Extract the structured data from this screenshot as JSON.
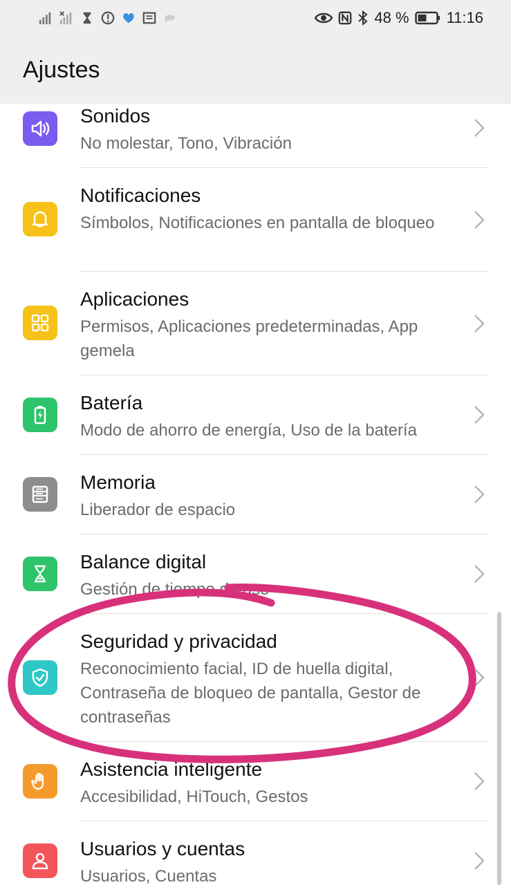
{
  "status_bar": {
    "left_icons": [
      "signal-icon",
      "signal-no-service-icon",
      "hourglass-icon",
      "alert-icon",
      "heart-chat-icon",
      "news-icon",
      "message-icon"
    ],
    "right_icons": [
      "eye-comfort-icon",
      "nfc-icon",
      "bluetooth-icon"
    ],
    "battery_percent": "48 %",
    "battery_level": 0.48,
    "time": "11:16"
  },
  "header": {
    "title": "Ajustes"
  },
  "colors": {
    "sound": "#7a5cf0",
    "notifications": "#f6c21a",
    "apps": "#f6c21a",
    "battery": "#2ec46b",
    "memory": "#8d8d8d",
    "digital_balance": "#2ec46b",
    "security": "#2fc6c6",
    "assistance": "#f59a2c",
    "users": "#f2555a",
    "annotation": "#d8317b"
  },
  "items": [
    {
      "icon": "speaker-icon",
      "title": "Sonidos",
      "subtitle": "No molestar, Tono, Vibración"
    },
    {
      "icon": "bell-icon",
      "title": "Notificaciones",
      "subtitle": "Símbolos, Notificaciones en pantalla de bloqueo"
    },
    {
      "icon": "apps-grid-icon",
      "title": "Aplicaciones",
      "subtitle": "Permisos, Aplicaciones predeterminadas, App gemela"
    },
    {
      "icon": "battery-icon",
      "title": "Batería",
      "subtitle": "Modo de ahorro de energía, Uso de la batería"
    },
    {
      "icon": "storage-icon",
      "title": "Memoria",
      "subtitle": "Liberador de espacio"
    },
    {
      "icon": "hourglass-icon",
      "title": "Balance digital",
      "subtitle": "Gestión de tiempo de uso"
    },
    {
      "icon": "shield-check-icon",
      "title": "Seguridad y privacidad",
      "subtitle": "Reconocimiento facial, ID de huella digital, Contraseña de bloqueo de pantalla, Gestor de contraseñas"
    },
    {
      "icon": "hand-icon",
      "title": "Asistencia inteligente",
      "subtitle": "Accesibilidad, HiTouch, Gestos"
    },
    {
      "icon": "user-icon",
      "title": "Usuarios y cuentas",
      "subtitle": "Usuarios, Cuentas"
    }
  ]
}
